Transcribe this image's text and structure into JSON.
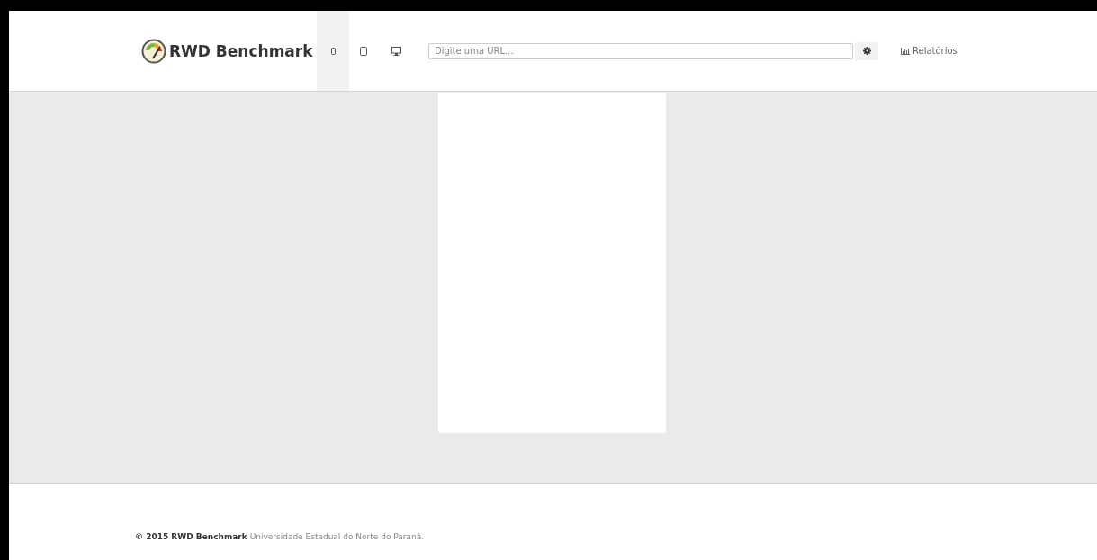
{
  "brand": {
    "name": "RWD Benchmark"
  },
  "devices": [
    {
      "kind": "mobile",
      "selected": true
    },
    {
      "kind": "tablet",
      "selected": false
    },
    {
      "kind": "desktop",
      "selected": false
    }
  ],
  "url_field": {
    "placeholder": "Digite uma URL..."
  },
  "nav": {
    "reports": "Relatórios"
  },
  "footer": {
    "text": "**© 2015 RWD Benchmark** Universidade Estadual do Norte do Paraná."
  }
}
